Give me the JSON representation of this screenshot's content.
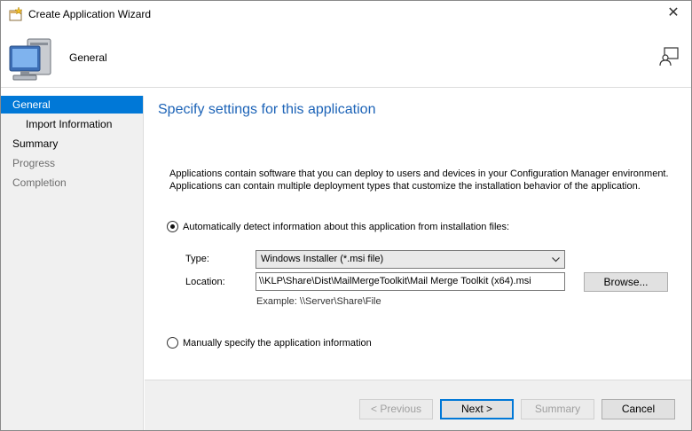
{
  "window": {
    "title": "Create Application Wizard",
    "close_glyph": "✕"
  },
  "header": {
    "page_name": "General"
  },
  "sidebar": {
    "items": [
      {
        "label": "General"
      },
      {
        "label": "Import Information"
      },
      {
        "label": "Summary"
      },
      {
        "label": "Progress"
      },
      {
        "label": "Completion"
      }
    ]
  },
  "main": {
    "heading": "Specify settings for this application",
    "description_line1": "Applications contain software that you can deploy to users and devices in your Configuration Manager environment.",
    "description_line2": "Applications can contain multiple deployment types that customize the installation behavior of the application.",
    "auto_detect": {
      "label": "Automatically detect information about this application from installation files:",
      "checked": true
    },
    "type": {
      "label": "Type:",
      "value": "Windows Installer (*.msi file)"
    },
    "location": {
      "label": "Location:",
      "value": "\\\\KLP\\Share\\Dist\\MailMergeToolkit\\Mail Merge Toolkit (x64).msi"
    },
    "browse_label": "Browse...",
    "example": "Example: \\\\Server\\Share\\File",
    "manual": {
      "label": "Manually specify the application information",
      "checked": false
    }
  },
  "footer": {
    "previous_label": "< Previous",
    "next_label": "Next >",
    "summary_label": "Summary",
    "cancel_label": "Cancel"
  },
  "colors": {
    "accent": "#0078d7",
    "heading": "#1c63b7",
    "sidebar_bg": "#f0f0f0"
  },
  "icons": [
    "wizard-app-icon",
    "close-icon",
    "computer-icon",
    "assistance-icon",
    "chevron-down-icon"
  ]
}
